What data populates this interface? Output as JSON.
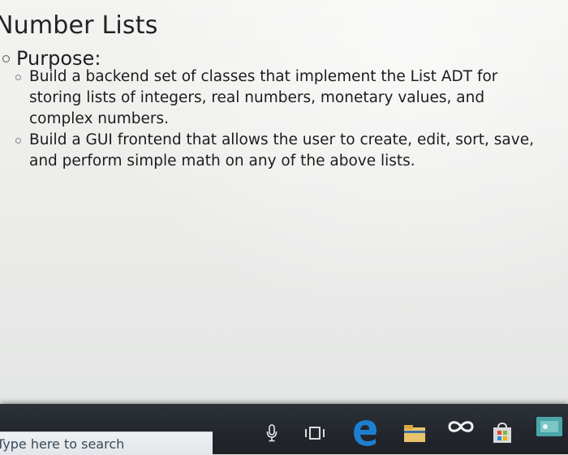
{
  "slide": {
    "title": "Number Lists",
    "heading": "Purpose:",
    "bullets": [
      "Build a backend set of classes that implement the List ADT for storing lists of integers, real numbers, monetary values, and complex numbers.",
      "Build a GUI frontend that allows the user to create, edit, sort, save, and perform simple math on any of the above lists."
    ]
  },
  "taskbar": {
    "search_placeholder": "Type here to search",
    "icons": [
      "microphone-icon",
      "task-view-icon",
      "edge-browser-icon",
      "file-explorer-icon",
      "infinity-app-icon",
      "store-icon",
      "pinned-app-icon"
    ],
    "colors": {
      "background": "#23272d",
      "edge_blue": "#1e7fd0",
      "store_green": "#3d9a3a",
      "app_teal": "#4aa6a8"
    }
  }
}
